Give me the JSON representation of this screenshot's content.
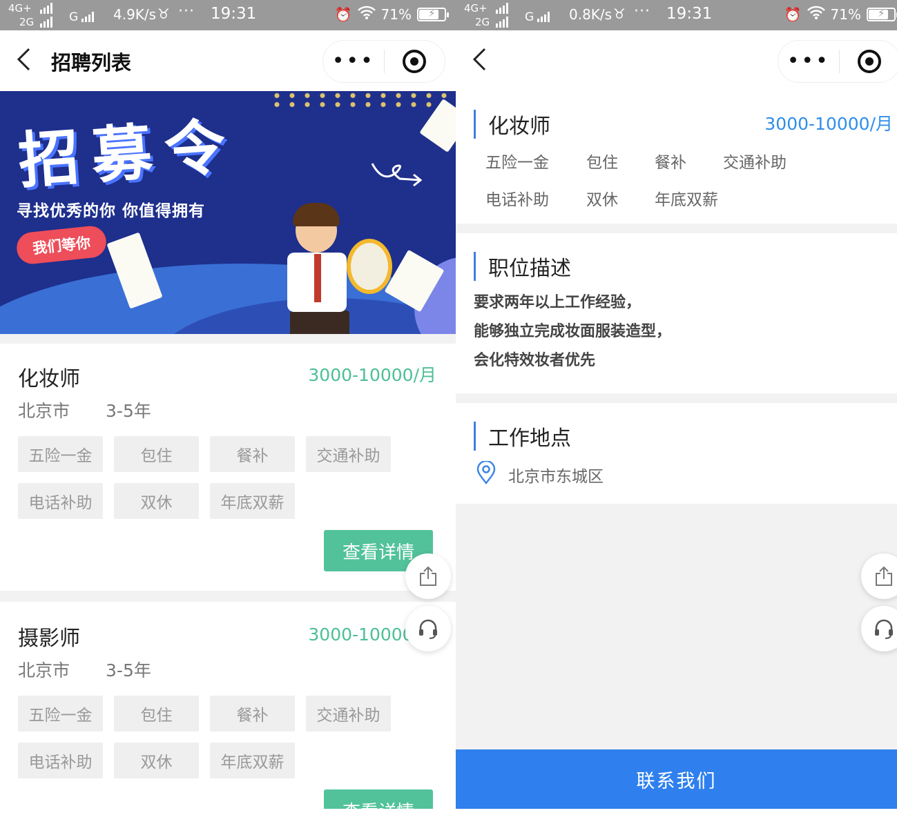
{
  "left": {
    "status": {
      "net": "4G+",
      "net2": "2G",
      "carrier": "G",
      "speed": "4.9K/s",
      "dots": "···",
      "time": "19:31",
      "battery": "71%"
    },
    "nav": {
      "back": "<",
      "title": "招聘列表",
      "more": "•••"
    },
    "banner": {
      "title": "招募令",
      "subtitle": "寻找优秀的你 你值得拥有",
      "pill": "我们等你"
    },
    "jobs": [
      {
        "title": "化妆师",
        "salary": "3000-10000/月",
        "city": "北京市",
        "years": "3-5年",
        "tags": [
          "五险一金",
          "包住",
          "餐补",
          "交通补助",
          "电话补助",
          "双休",
          "年底双薪"
        ],
        "button": "查看详情"
      },
      {
        "title": "摄影师",
        "salary": "3000-10000/月",
        "city": "北京市",
        "years": "3-5年",
        "tags": [
          "五险一金",
          "包住",
          "餐补",
          "交通补助",
          "电话补助",
          "双休",
          "年底双薪"
        ],
        "button": "查看详情"
      }
    ]
  },
  "right": {
    "status": {
      "net": "4G+",
      "net2": "2G",
      "carrier": "G",
      "speed": "0.8K/s",
      "dots": "···",
      "time": "19:31",
      "battery": "71%"
    },
    "nav": {
      "back": "<",
      "more": "•••"
    },
    "job": {
      "title": "化妆师",
      "salary": "3000-10000/月",
      "tags": [
        "五险一金",
        "包住",
        "餐补",
        "交通补助",
        "电话补助",
        "双休",
        "年底双薪"
      ]
    },
    "description": {
      "heading": "职位描述",
      "lines": [
        "要求两年以上工作经验，",
        "能够独立完成妆面服装造型，",
        "会化特效妆者优先"
      ]
    },
    "location": {
      "heading": "工作地点",
      "address": "北京市东城区"
    },
    "contact_button": "联系我们"
  },
  "colors": {
    "salary_green": "#4cbf95",
    "button_green": "#52c29b",
    "accent_blue": "#2f80ee",
    "banner_navy": "#1e2f8c"
  },
  "icons": [
    "back-arrow-icon",
    "more-dots-icon",
    "target-record-icon",
    "share-icon",
    "headset-icon",
    "location-pin-icon",
    "alarm-icon",
    "wifi-icon",
    "battery-icon"
  ]
}
